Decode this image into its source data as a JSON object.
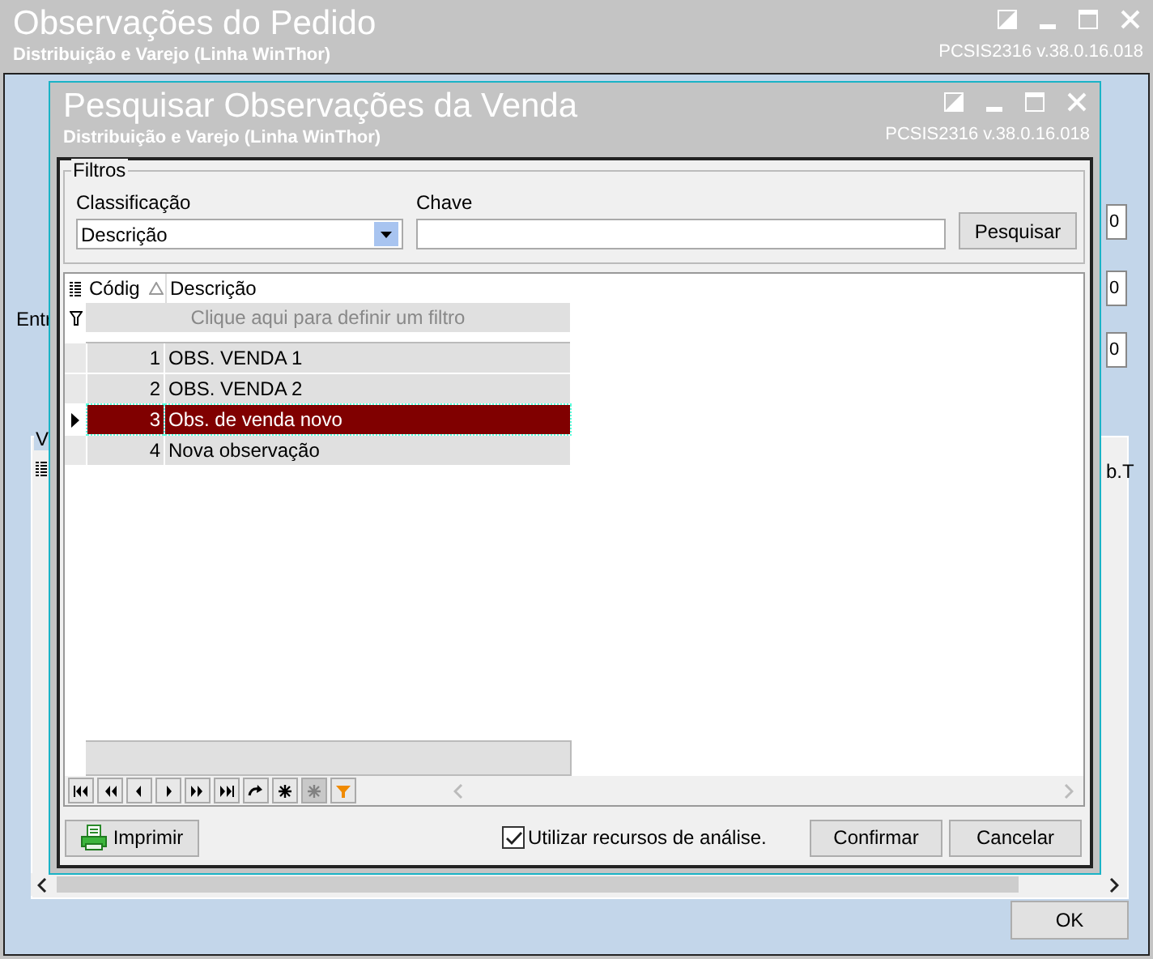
{
  "window": {
    "title": "Observações do Pedido",
    "subtitle": "Distribuição e Varejo (Linha WinThor)",
    "version": "PCSIS2316  v.38.0.16.018"
  },
  "background": {
    "labels": [
      {
        "text": "Entr",
        "kind": "low"
      }
    ],
    "fields": [
      "0",
      "0",
      "0"
    ],
    "group_label": "V",
    "cell_text": "b.T",
    "ok_button": "OK"
  },
  "dialog": {
    "title": "Pesquisar Observações da Venda",
    "subtitle": "Distribuição e Varejo (Linha WinThor)",
    "version": "PCSIS2316  v.38.0.16.018",
    "filters": {
      "group_label": "Filtros",
      "classification_label": "Classificação",
      "classification_value": "Descrição",
      "key_label": "Chave",
      "search_button": "Pesquisar"
    },
    "grid": {
      "columns": [
        {
          "label": "Códig",
          "sorted": true
        },
        {
          "label": "Descrição",
          "sorted": false
        }
      ],
      "filter_hint": "Clique aqui para definir um filtro",
      "rows": [
        {
          "code": "1",
          "description": "OBS. VENDA 1",
          "selected": false
        },
        {
          "code": "2",
          "description": "OBS. VENDA 2",
          "selected": false
        },
        {
          "code": "3",
          "description": "Obs. de venda novo",
          "selected": true
        },
        {
          "code": "4",
          "description": "Nova observação",
          "selected": false
        }
      ],
      "navigator": [
        {
          "kind": "first",
          "disabled": false
        },
        {
          "kind": "prior-page",
          "disabled": false
        },
        {
          "kind": "prior",
          "disabled": false
        },
        {
          "kind": "next",
          "disabled": false
        },
        {
          "kind": "next-page",
          "disabled": false
        },
        {
          "kind": "last",
          "disabled": false
        },
        {
          "kind": "refresh",
          "disabled": false
        },
        {
          "kind": "insert",
          "disabled": false
        },
        {
          "kind": "insert",
          "disabled": true
        },
        {
          "kind": "filter",
          "disabled": false
        }
      ]
    },
    "print_button": "Imprimir",
    "analysis_checkbox": {
      "label": "Utilizar recursos de análise.",
      "checked": true
    },
    "buttons": [
      "Confirmar",
      "Cancelar"
    ]
  }
}
